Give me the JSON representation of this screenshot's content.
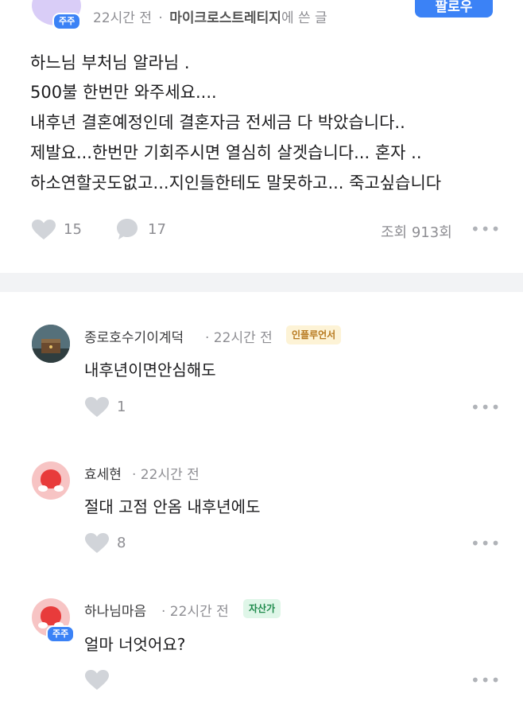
{
  "post": {
    "author_badge": "주주",
    "meta_time": "22시간 전",
    "meta_sep": "·",
    "meta_board": "마이크로스트레티지",
    "meta_suffix": "에 쓴 글",
    "follow_label": "팔로우",
    "lines": [
      "하느님 부처님 알라님 .",
      "500불 한번만 와주세요....",
      "내후년 결혼예정인데 결혼자금 전세금 다 박았습니다..",
      "제발요...한번만 기회주시면 열심히 살겟습니다... 혼자 ..",
      "하소연할곳도없고...지인들한테도 말못하고... 죽고싶습니다"
    ],
    "likes": "15",
    "comments": "17",
    "views": "조회 913회"
  },
  "comments": [
    {
      "name": "종로호수기이계덕",
      "time": "· 22시간 전",
      "tag": "인플루언서",
      "text": "내후년이면안심해도",
      "likes": "1"
    },
    {
      "name": "효세현",
      "time": "· 22시간 전",
      "text": "절대 고점 안옴 내후년에도",
      "likes": "8"
    },
    {
      "name": "하나님마음",
      "time": "· 22시간 전",
      "tag": "자산가",
      "badge": "주주",
      "text": "얼마 너엇어요?",
      "likes": ""
    }
  ],
  "icons": {
    "more": "•••"
  },
  "colors": {
    "accent": "#3b82f6",
    "muted": "#8e8e93",
    "icon_grey": "#c7cacf"
  }
}
